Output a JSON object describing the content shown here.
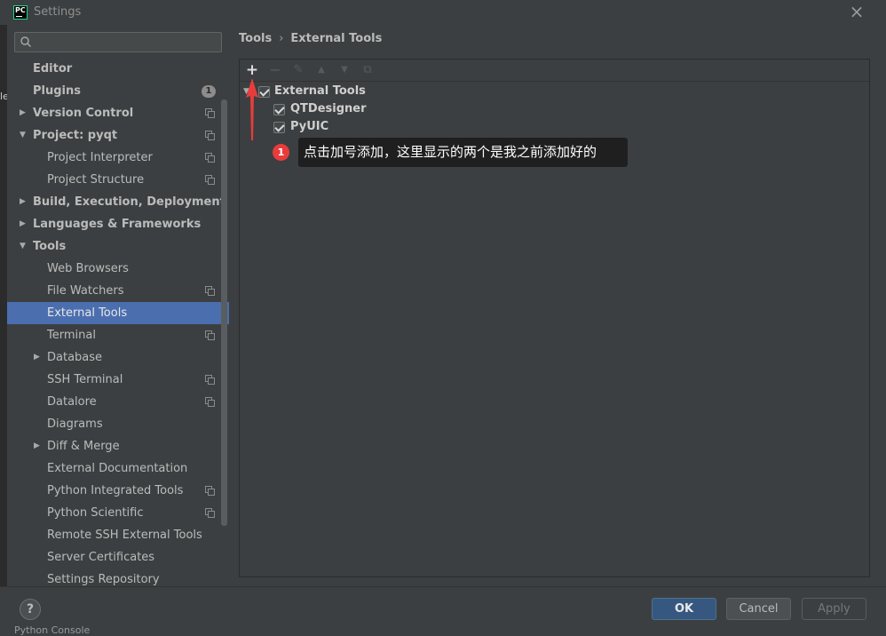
{
  "window": {
    "title": "Settings",
    "close_label": "×"
  },
  "search": {
    "placeholder": "Q▾",
    "value": ""
  },
  "sidebar": {
    "items": [
      {
        "label": "Editor",
        "level": 0,
        "arrow": "",
        "badge": "",
        "copy": false,
        "selected": false
      },
      {
        "label": "Plugins",
        "level": 0,
        "arrow": "",
        "badge": "1",
        "copy": false,
        "selected": false
      },
      {
        "label": "Version Control",
        "level": 0,
        "arrow": "▶",
        "badge": "",
        "copy": true,
        "selected": false
      },
      {
        "label": "Project: pyqt",
        "level": 0,
        "arrow": "▼",
        "badge": "",
        "copy": true,
        "selected": false
      },
      {
        "label": "Project Interpreter",
        "level": 1,
        "arrow": "",
        "badge": "",
        "copy": true,
        "selected": false
      },
      {
        "label": "Project Structure",
        "level": 1,
        "arrow": "",
        "badge": "",
        "copy": true,
        "selected": false
      },
      {
        "label": "Build, Execution, Deployment",
        "level": 0,
        "arrow": "▶",
        "badge": "",
        "copy": false,
        "selected": false
      },
      {
        "label": "Languages & Frameworks",
        "level": 0,
        "arrow": "▶",
        "badge": "",
        "copy": false,
        "selected": false
      },
      {
        "label": "Tools",
        "level": 0,
        "arrow": "▼",
        "badge": "",
        "copy": false,
        "selected": false
      },
      {
        "label": "Web Browsers",
        "level": 1,
        "arrow": "",
        "badge": "",
        "copy": false,
        "selected": false
      },
      {
        "label": "File Watchers",
        "level": 1,
        "arrow": "",
        "badge": "",
        "copy": true,
        "selected": false
      },
      {
        "label": "External Tools",
        "level": 1,
        "arrow": "",
        "badge": "",
        "copy": false,
        "selected": true
      },
      {
        "label": "Terminal",
        "level": 1,
        "arrow": "",
        "badge": "",
        "copy": true,
        "selected": false
      },
      {
        "label": "Database",
        "level": 1,
        "arrow": "▶",
        "badge": "",
        "copy": false,
        "selected": false
      },
      {
        "label": "SSH Terminal",
        "level": 1,
        "arrow": "",
        "badge": "",
        "copy": true,
        "selected": false
      },
      {
        "label": "Datalore",
        "level": 1,
        "arrow": "",
        "badge": "",
        "copy": true,
        "selected": false
      },
      {
        "label": "Diagrams",
        "level": 1,
        "arrow": "",
        "badge": "",
        "copy": false,
        "selected": false
      },
      {
        "label": "Diff & Merge",
        "level": 1,
        "arrow": "▶",
        "badge": "",
        "copy": false,
        "selected": false
      },
      {
        "label": "External Documentation",
        "level": 1,
        "arrow": "",
        "badge": "",
        "copy": false,
        "selected": false
      },
      {
        "label": "Python Integrated Tools",
        "level": 1,
        "arrow": "",
        "badge": "",
        "copy": true,
        "selected": false
      },
      {
        "label": "Python Scientific",
        "level": 1,
        "arrow": "",
        "badge": "",
        "copy": true,
        "selected": false
      },
      {
        "label": "Remote SSH External Tools",
        "level": 1,
        "arrow": "",
        "badge": "",
        "copy": false,
        "selected": false
      },
      {
        "label": "Server Certificates",
        "level": 1,
        "arrow": "",
        "badge": "",
        "copy": false,
        "selected": false
      },
      {
        "label": "Settings Repository",
        "level": 1,
        "arrow": "",
        "badge": "",
        "copy": false,
        "selected": false
      }
    ]
  },
  "breadcrumb": {
    "parent": "Tools",
    "separator": "›",
    "current": "External Tools"
  },
  "toolbar": {
    "add": "+",
    "remove": "−",
    "edit": "✎",
    "up": "▲",
    "down": "▼",
    "copy": "⧉"
  },
  "tools_tree": {
    "group": {
      "label": "External Tools",
      "checked": true,
      "toggle": "▼"
    },
    "children": [
      {
        "label": "QTDesigner",
        "checked": true
      },
      {
        "label": "PyUIC",
        "checked": true
      }
    ]
  },
  "annotation": {
    "step": "1",
    "text": "点击加号添加，这里显示的两个是我之前添加好的",
    "color": "#e83c3c"
  },
  "footer": {
    "help": "?",
    "ok": "OK",
    "cancel": "Cancel",
    "apply": "Apply"
  },
  "background": {
    "bottom_text": "Python Console",
    "left_edge_text": "le"
  },
  "colors": {
    "selection": "#4b6eaf",
    "panel": "#3c3f41",
    "ok_button": "#365880"
  }
}
